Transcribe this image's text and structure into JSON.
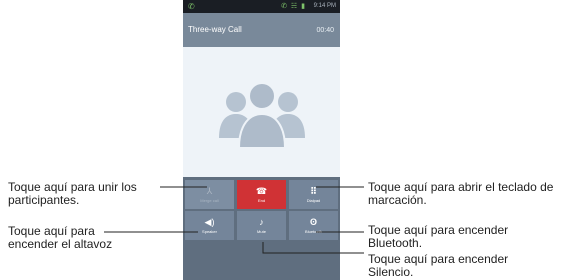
{
  "status_bar": {
    "call_indicator": "✆",
    "icons": "✆ ☵ ▮",
    "time": "9:14 PM"
  },
  "call_header": {
    "title": "Three-way Call",
    "timer": "00:40"
  },
  "buttons": {
    "merge_call": {
      "label": "Merge call",
      "icon": "merge-icon",
      "glyph": "⅄"
    },
    "end": {
      "label": "End",
      "icon": "hangup-icon",
      "glyph": "☎"
    },
    "dialpad": {
      "label": "Dialpad",
      "icon": "dialpad-icon",
      "glyph": "⠿"
    },
    "speaker": {
      "label": "Speaker",
      "icon": "speaker-icon",
      "glyph": "◀)"
    },
    "mute": {
      "label": "Mute",
      "icon": "microphone-icon",
      "glyph": "♪"
    },
    "bluetooth": {
      "label": "Bluetooth",
      "icon": "bluetooth-icon",
      "glyph": "ʘ"
    }
  },
  "annotations": {
    "merge": [
      "Toque aquí para unir los",
      "participantes."
    ],
    "speaker": [
      "Toque aquí para",
      "encender el altavoz"
    ],
    "dialpad": [
      "Toque aquí para abrir el teclado de",
      "marcación."
    ],
    "bluetooth": [
      "Toque aquí para encender",
      "Bluetooth."
    ],
    "mute": [
      "Toque aquí para encender",
      "Silencio."
    ]
  },
  "colors": {
    "status_bar": "#1a1e24",
    "call_header": "#79899a",
    "screen_bg": "#eef3f8",
    "button": "#74859a",
    "end_button": "#d03235",
    "avatar": "#b6c3d1"
  }
}
